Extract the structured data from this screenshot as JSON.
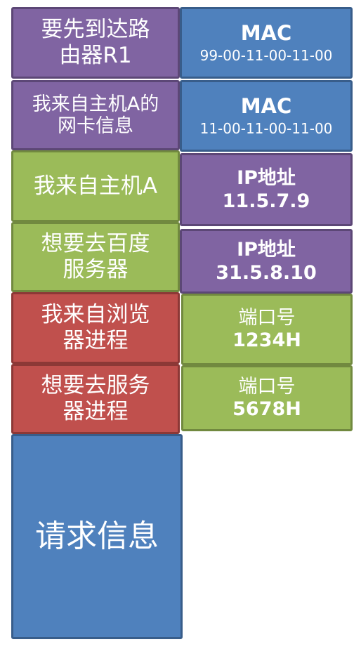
{
  "left": {
    "router_dest": "要先到达路\n由器R1",
    "from_nic": "我来自主机A的\n网卡信息",
    "from_host": "我来自主机A",
    "to_server": "想要去百度\n服务器",
    "from_browser": "我来自浏览\n器进程",
    "to_server_process": "想要去服务\n器进程",
    "request": "请求信息"
  },
  "right": {
    "mac1_label": "MAC",
    "mac1_value": "99-00-11-00-11-00",
    "mac2_label": "MAC",
    "mac2_value": "11-00-11-00-11-00",
    "ip1_label": "IP地址",
    "ip1_value": "11.5.7.9",
    "ip2_label": "IP地址",
    "ip2_value": "31.5.8.10",
    "port1_label": "端口号",
    "port1_value": "1234H",
    "port2_label": "端口号",
    "port2_value": "5678H"
  },
  "colors": {
    "purple": "#8064a2",
    "blue": "#4f81bd",
    "green": "#9bbb59",
    "red": "#c0504d"
  }
}
